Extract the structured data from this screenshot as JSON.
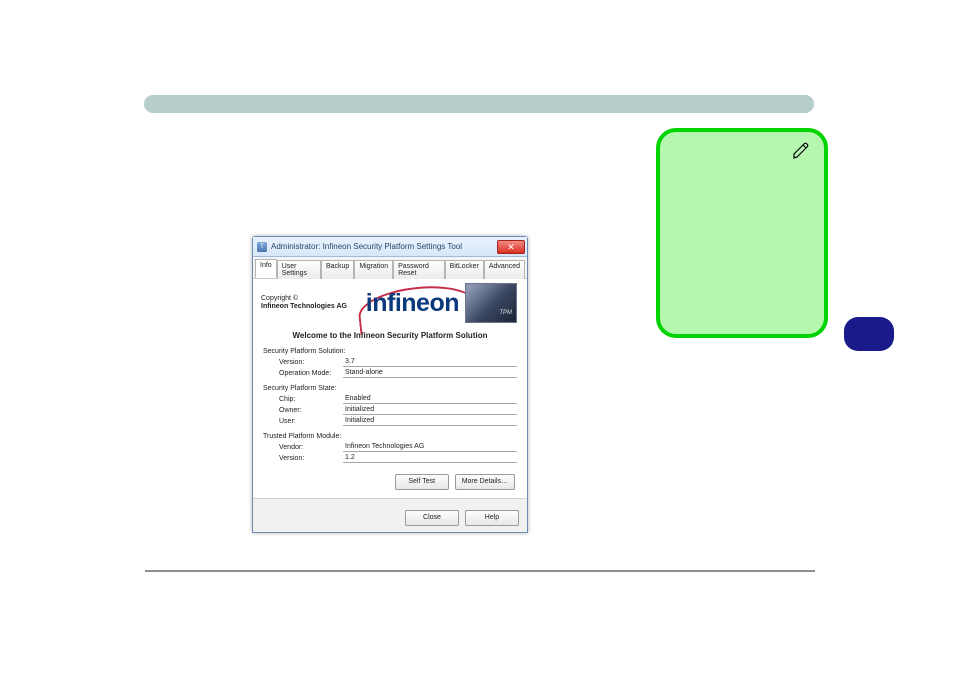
{
  "window": {
    "title": "Administrator: Infineon Security Platform Settings Tool",
    "close_glyph": "✕"
  },
  "tabs": [
    {
      "label": "Info",
      "active": true
    },
    {
      "label": "User Settings"
    },
    {
      "label": "Backup"
    },
    {
      "label": "Migration"
    },
    {
      "label": "Password Reset"
    },
    {
      "label": "BitLocker"
    },
    {
      "label": "Advanced"
    }
  ],
  "copyright": {
    "line1": "Copyright ©",
    "line2": "Infineon Technologies AG"
  },
  "logo_text": "infineon",
  "chip_label": "TPM",
  "welcome": "Welcome to the Infineon Security Platform Solution",
  "sections": {
    "solution": {
      "title": "Security Platform Solution:",
      "version_lbl": "Version:",
      "version_val": "3.7",
      "mode_lbl": "Operation Mode:",
      "mode_val": "Stand-alone"
    },
    "state": {
      "title": "Security Platform State:",
      "chip_lbl": "Chip:",
      "chip_val": "Enabled",
      "owner_lbl": "Owner:",
      "owner_val": "Initialized",
      "user_lbl": "User:",
      "user_val": "Initialized"
    },
    "tpm": {
      "title": "Trusted Platform Module:",
      "vendor_lbl": "Vendor:",
      "vendor_val": "Infineon Technologies AG",
      "version_lbl": "Version:",
      "version_val": "1.2"
    }
  },
  "buttons": {
    "self_test": "Self Test",
    "more_details": "More Details…",
    "close": "Close",
    "help": "Help"
  }
}
